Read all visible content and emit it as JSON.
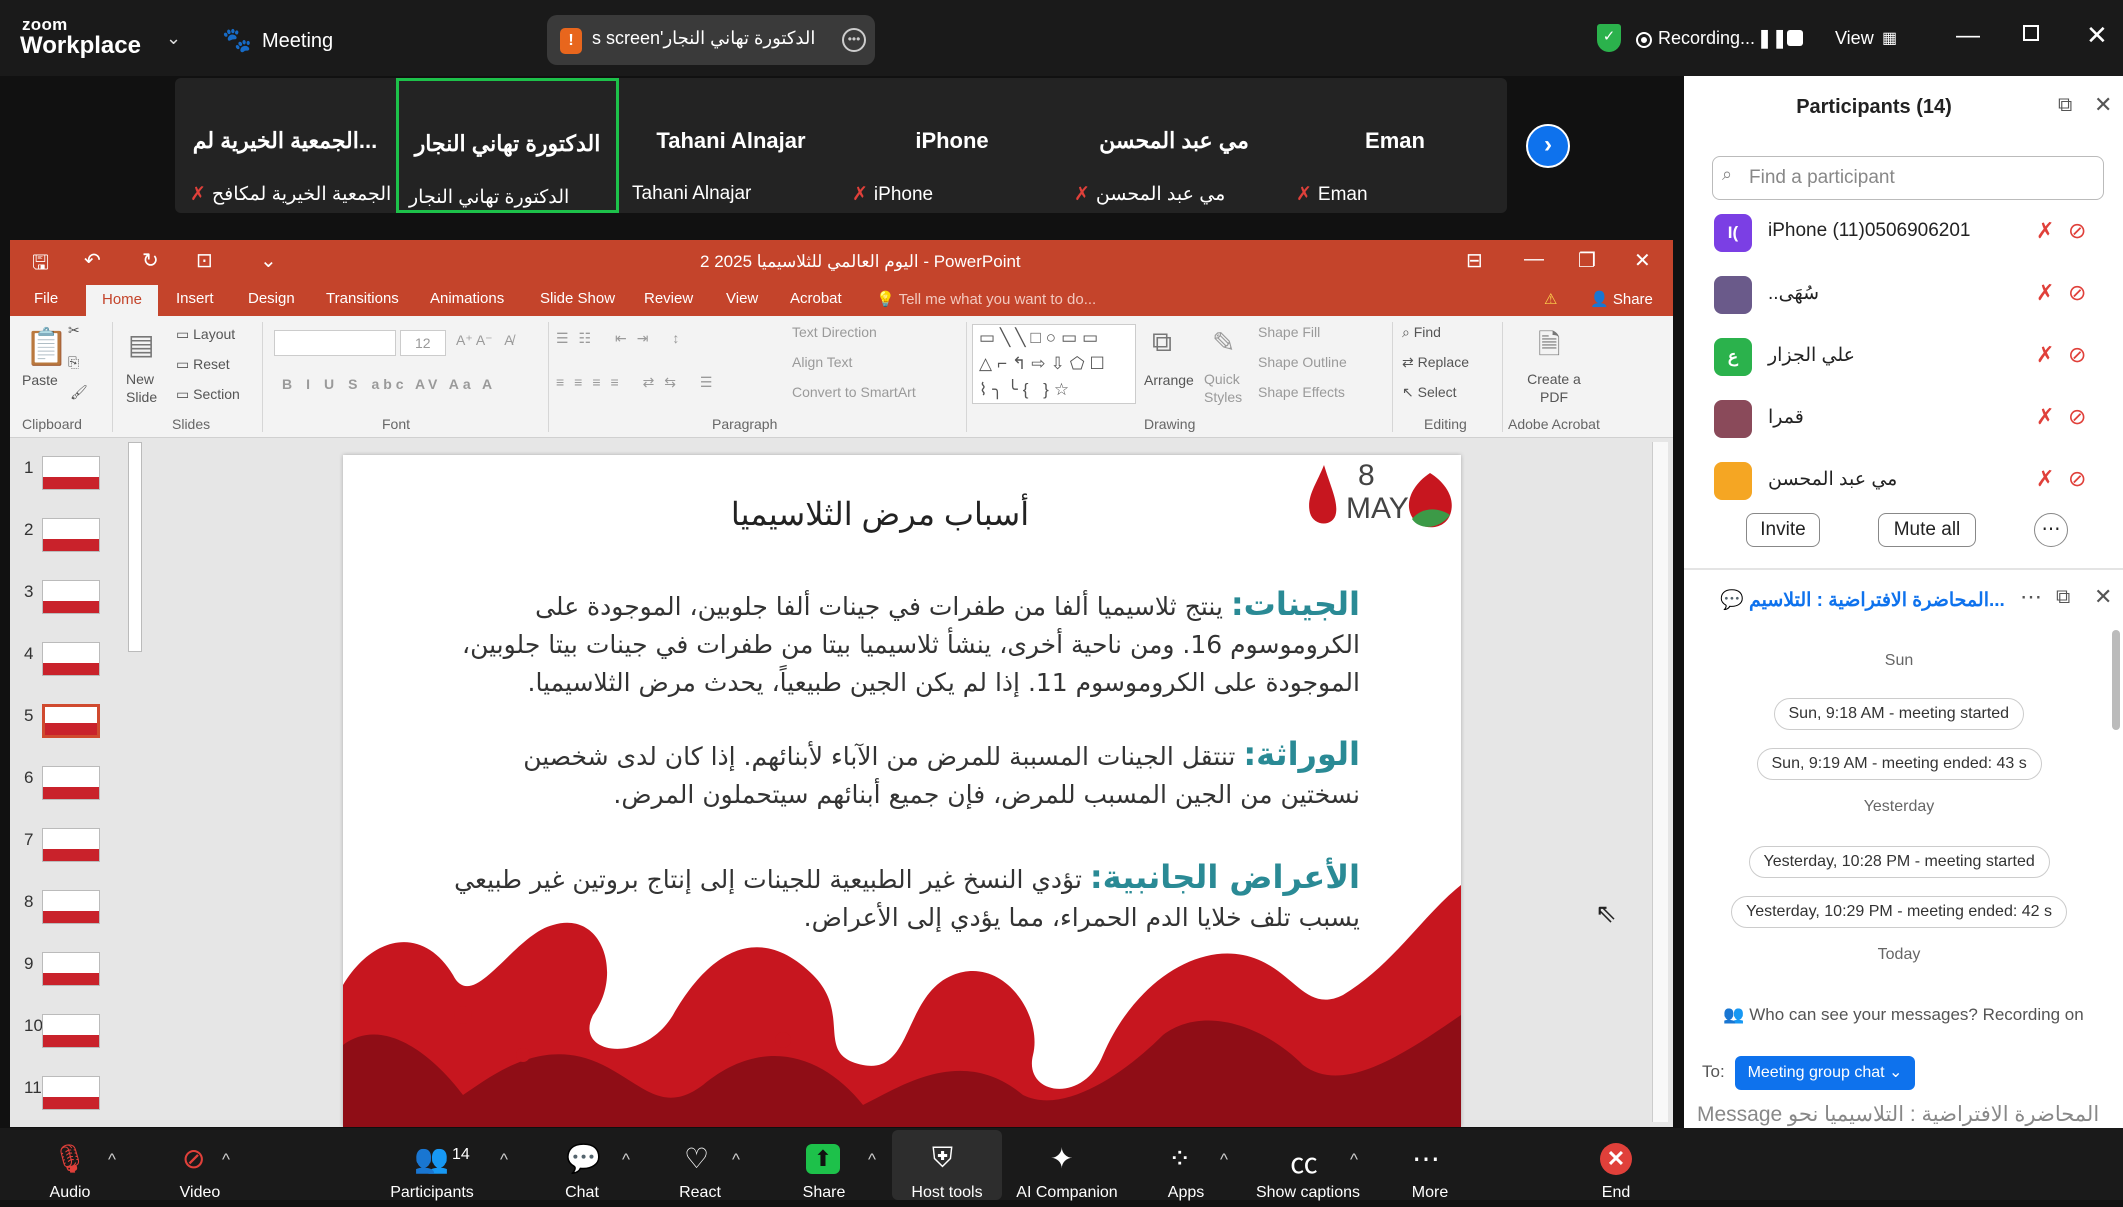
{
  "app": {
    "logo_top": "zoom",
    "logo_bottom": "Workplace",
    "meeting_label": "Meeting"
  },
  "share_pill": {
    "badge": "!",
    "text": "الدكتورة تهاني النجار's screen"
  },
  "recording": {
    "label": "Recording...",
    "view": "View"
  },
  "tiles": [
    {
      "name": "الجمعية الخيرية لم...",
      "sub": "الجمعية الخيرية لمكافح"
    },
    {
      "name": "الدكتورة تهاني النجار",
      "sub": "الدكتورة تهاني النجار"
    },
    {
      "name": "Tahani Alnajar",
      "sub": "Tahani Alnajar"
    },
    {
      "name": "iPhone",
      "sub": "iPhone"
    },
    {
      "name": "مي عبد المحسن",
      "sub": "مي عبد المحسن"
    },
    {
      "name": "Eman",
      "sub": "Eman"
    }
  ],
  "powerpoint": {
    "title": "اليوم العالمي للثلاسيميا 2025 2 - PowerPoint",
    "tabs": [
      "File",
      "Home",
      "Insert",
      "Design",
      "Transitions",
      "Animations",
      "Slide Show",
      "Review",
      "View",
      "Acrobat",
      "Tell me what you want to do...",
      "Share"
    ],
    "ribbon": {
      "paste": "Paste",
      "new_slide": "New Slide",
      "layout": "Layout",
      "reset": "Reset",
      "section": "Section",
      "font_size": "12",
      "text_direction": "Text Direction",
      "align_text": "Align Text",
      "convert_smartart": "Convert to SmartArt",
      "arrange": "Arrange",
      "quick_styles": "Quick Styles",
      "shape_fill": "Shape Fill",
      "shape_outline": "Shape Outline",
      "shape_effects": "Shape Effects",
      "find": "Find",
      "replace": "Replace",
      "select": "Select",
      "create_pdf": "Create a PDF",
      "groups": [
        "Clipboard",
        "Slides",
        "Font",
        "Paragraph",
        "Drawing",
        "Editing",
        "Adobe Acrobat"
      ]
    },
    "thumb_numbers": [
      "1",
      "2",
      "3",
      "4",
      "5",
      "6",
      "7",
      "8",
      "9",
      "10",
      "11"
    ],
    "slide": {
      "title": "أسباب مرض الثلاسيميا",
      "logo_num": "8",
      "logo_month": "MAY",
      "p1_head": "الجينات:",
      "p1_body": "ينتج ثلاسيميا ألفا من طفرات في جينات ألفا جلوبين، الموجودة على الكروموسوم 16. ومن ناحية أخرى، ينشأ ثلاسيميا بيتا من طفرات في جينات بيتا جلوبين، الموجودة على الكروموسوم 11. إذا لم يكن الجين طبيعياً، يحدث مرض الثلاسيميا.",
      "p2_head": "الوراثة:",
      "p2_body": "تنتقل الجينات المسببة للمرض من الآباء لأبنائهم. إذا كان لدى شخصين نسختين من الجين المسبب للمرض، فإن جميع أبنائهم سيتحملون المرض.",
      "p3_head": "الأعراض الجانبية:",
      "p3_body": "تؤدي النسخ غير الطبيعية للجينات إلى إنتاج بروتين غير طبيعي يسبب تلف خلايا الدم الحمراء، مما يؤدي إلى الأعراض."
    }
  },
  "participants": {
    "title": "Participants (14)",
    "search_placeholder": "Find a participant",
    "list": [
      {
        "avatar": "I(",
        "name": "iPhone (11)0506906201",
        "color": "#7b3fe4"
      },
      {
        "avatar": "",
        "name": "..سُهَى",
        "color": "#6a5a8a"
      },
      {
        "avatar": "ع",
        "name": "علي الجزار",
        "color": "#2bb24c"
      },
      {
        "avatar": "",
        "name": "قمرا",
        "color": "#8a4a5a"
      },
      {
        "avatar": "",
        "name": "مي عبد المحسن",
        "color": "#f5a623"
      }
    ],
    "invite": "Invite",
    "mute_all": "Mute all"
  },
  "chat": {
    "title": "المحاضرة الافتراضية : التلاسيم...",
    "items": [
      {
        "type": "day",
        "text": "Sun"
      },
      {
        "type": "pill",
        "text": "Sun, 9:18 AM - meeting started"
      },
      {
        "type": "pill",
        "text": "Sun, 9:19 AM - meeting ended: 43 s"
      },
      {
        "type": "day",
        "text": "Yesterday"
      },
      {
        "type": "pill",
        "text": "Yesterday, 10:28 PM - meeting started"
      },
      {
        "type": "pill",
        "text": "Yesterday, 10:29 PM - meeting ended: 42 s"
      },
      {
        "type": "day",
        "text": "Today"
      }
    ],
    "who_can_see": "Who can see your messages? Recording on",
    "to_label": "To:",
    "to_value": "Meeting group chat",
    "message_placeholder": "Message المحاضرة الافتراضية : التلاسيميا نحو وعي صحي يبدأ بالمعرفة"
  },
  "toolbar": {
    "audio": "Audio",
    "video": "Video",
    "participants": "Participants",
    "participants_count": "14",
    "chat": "Chat",
    "react": "React",
    "share": "Share",
    "host_tools": "Host tools",
    "ai_companion": "AI Companion",
    "apps": "Apps",
    "captions": "Show captions",
    "more": "More",
    "end": "End"
  }
}
